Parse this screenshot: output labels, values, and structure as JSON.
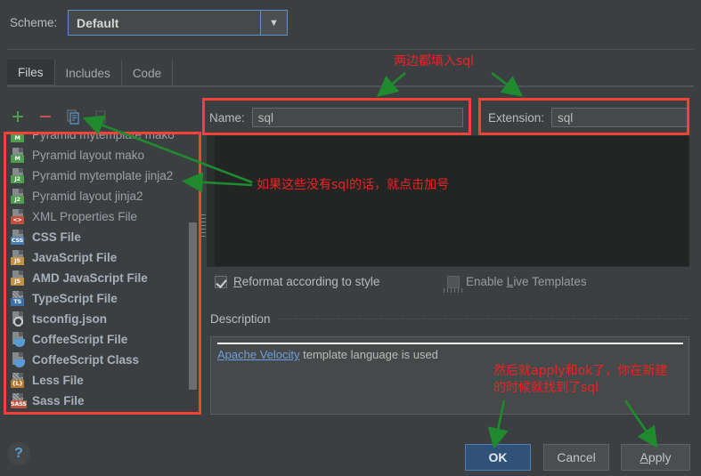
{
  "scheme": {
    "label": "Scheme:",
    "value": "Default",
    "arrow_icon": "chevron-down-icon"
  },
  "tabs": [
    {
      "label": "Files",
      "active": true
    },
    {
      "label": "Includes",
      "active": false
    },
    {
      "label": "Code",
      "active": false
    }
  ],
  "list_toolbar": [
    {
      "name": "add-button",
      "icon": "plus-icon",
      "color": "#4f9e4f",
      "enabled": true
    },
    {
      "name": "remove-button",
      "icon": "minus-icon",
      "color": "#c9524c",
      "enabled": true
    },
    {
      "name": "copy-button",
      "icon": "copy-icon",
      "color": "#5b9bd5",
      "enabled": true
    },
    {
      "name": "export-button",
      "icon": "save-as-icon",
      "color": "#5c6062",
      "enabled": false
    }
  ],
  "file_list": [
    {
      "label": "Pyramid mytemplate mako",
      "badge": "M",
      "badge_color": "#4f9e4f",
      "bold": false,
      "hatch": false
    },
    {
      "label": "Pyramid layout mako",
      "badge": "M",
      "badge_color": "#4f9e4f",
      "bold": false,
      "hatch": false
    },
    {
      "label": "Pyramid mytemplate jinja2",
      "badge": "J2",
      "badge_color": "#4f9e4f",
      "bold": false,
      "hatch": false
    },
    {
      "label": "Pyramid layout jinja2",
      "badge": "J2",
      "badge_color": "#4f9e4f",
      "bold": false,
      "hatch": false
    },
    {
      "label": "XML Properties File",
      "badge": "<>",
      "badge_color": "#c0503c",
      "bold": false,
      "hatch": false
    },
    {
      "label": "CSS File",
      "badge": "CSS",
      "badge_color": "#4a7cae",
      "bold": true,
      "hatch": false
    },
    {
      "label": "JavaScript File",
      "badge": "JS",
      "badge_color": "#c3923f",
      "bold": true,
      "hatch": false
    },
    {
      "label": "AMD JavaScript File",
      "badge": "JS",
      "badge_color": "#c3923f",
      "bold": true,
      "hatch": false
    },
    {
      "label": "TypeScript File",
      "badge": "TS",
      "badge_color": "#3c6fa8",
      "bold": true,
      "hatch": true
    },
    {
      "label": "tsconfig.json",
      "badge": "gear",
      "badge_color": "#c9ccce",
      "bold": true,
      "hatch": false
    },
    {
      "label": "CoffeeScript File",
      "badge": "cup",
      "badge_color": "#5b9bd5",
      "bold": true,
      "hatch": false
    },
    {
      "label": "CoffeeScript Class",
      "badge": "cup",
      "badge_color": "#5b9bd5",
      "bold": true,
      "hatch": false
    },
    {
      "label": "Less File",
      "badge": "{L}",
      "badge_color": "#b2762e",
      "bold": true,
      "hatch": true
    },
    {
      "label": "Sass File",
      "badge": "SASS",
      "badge_color": "#c0503c",
      "bold": true,
      "hatch": true
    },
    {
      "label": "",
      "badge": "",
      "badge_color": "#7a7d7f",
      "bold": false,
      "hatch": true
    }
  ],
  "name_field": {
    "label": "Name:",
    "value": "sql",
    "placeholder": ""
  },
  "extension_field": {
    "label": "Extension:",
    "value": "sql",
    "placeholder": ""
  },
  "editor": {
    "content": ""
  },
  "options": {
    "reformat": {
      "label_prefix": "",
      "label_mnemonic": "R",
      "label_rest": "eformat according to style",
      "checked": true,
      "enabled": true
    },
    "live_templates": {
      "label_prefix": "Enable ",
      "label_mnemonic": "L",
      "label_rest": "ive Templates",
      "checked": false,
      "enabled": false
    }
  },
  "description": {
    "title": "Description",
    "link_text": "Apache Velocity",
    "body_text": " template language is used"
  },
  "footer": {
    "help_label": "?",
    "ok_label": "OK",
    "cancel_label": "Cancel",
    "apply_mnemonic": "A",
    "apply_rest": "pply"
  },
  "annotations": {
    "top": "两边都填入sql",
    "middle": "如果这些没有sql的话，就点击加号",
    "bottom_line1": "然后就apply和ok了，你在新建",
    "bottom_line2": "的时候就找到了sql",
    "box_color": "#f44336",
    "arrow_color": "#1f8a2e",
    "text_color": "#ee2222"
  }
}
